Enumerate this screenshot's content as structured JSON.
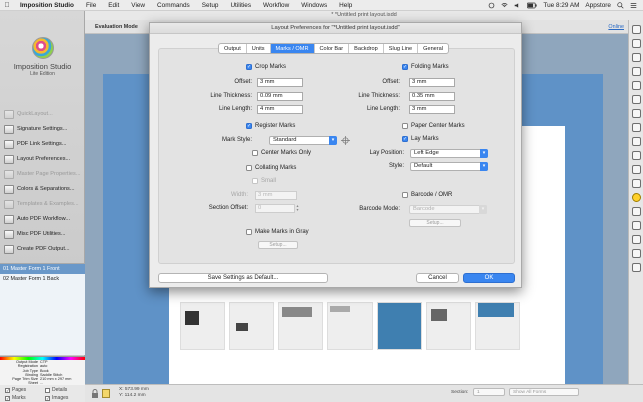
{
  "menubar": {
    "app_name": "Imposition Studio",
    "items": [
      "File",
      "Edit",
      "View",
      "Commands",
      "Setup",
      "Utilities",
      "Workflow",
      "Windows",
      "Help"
    ],
    "clock": "Tue 8:29 AM",
    "user": "Appstore"
  },
  "document": {
    "title": "* *Untitled print layout.isdd",
    "mode_label": "Evaluation Mode",
    "online_link": "Online"
  },
  "sidebar": {
    "logo_title": "Imposition Studio",
    "logo_subtitle": "Lite Edition",
    "items": [
      {
        "label": "QuickLayout...",
        "dim": true
      },
      {
        "label": "Signature Settings...",
        "dim": false
      },
      {
        "label": "PDF Link Settings...",
        "dim": false
      },
      {
        "label": "Layout Preferences...",
        "dim": false
      },
      {
        "label": "Master Page Properties...",
        "dim": true
      },
      {
        "label": "Colors & Separations...",
        "dim": false
      },
      {
        "label": "Templates & Examples...",
        "dim": true
      },
      {
        "label": "Auto PDF Workflow...",
        "dim": false
      },
      {
        "label": "Misc PDF Utilities...",
        "dim": false
      },
      {
        "label": "Create PDF Output...",
        "dim": false
      }
    ],
    "forms": [
      "01 Master Form 1 Front",
      "02 Master Form 1 Back"
    ],
    "info": [
      {
        "k": "Output Mode",
        "v": "CTP"
      },
      {
        "k": "Registration",
        "v": "auto"
      },
      {
        "k": "Job Type",
        "v": "Book"
      },
      {
        "k": "Binding",
        "v": "Saddle Stitch"
      },
      {
        "k": "Page Trim Size",
        "v": "210 mm x 297 mm"
      },
      {
        "k": "Sheet",
        "v": "..."
      }
    ]
  },
  "statusbar": {
    "checks": [
      {
        "label": "Pages",
        "checked": true
      },
      {
        "label": "Details",
        "checked": false
      },
      {
        "label": "Marks",
        "checked": true
      },
      {
        "label": "Images",
        "checked": true
      }
    ],
    "x_readout": "X: 573.99 mm",
    "y_readout": "Y: 114.2 mm",
    "section_label": "Section:",
    "section_value": "1",
    "forms_filter": "Show All Forms"
  },
  "dialog": {
    "title": "Layout Preferences for \"*Untitled print layout.isdd\"",
    "tabs": [
      "Output",
      "Units",
      "Marks / OMR",
      "Color Bar",
      "Backdrop",
      "Slug Line",
      "General"
    ],
    "active_tab": "Marks / OMR",
    "crop_marks": {
      "label": "Crop Marks",
      "checked": true
    },
    "crop_offset": {
      "label": "Offset:",
      "value": "3 mm"
    },
    "crop_thickness": {
      "label": "Line Thickness:",
      "value": "0.09 mm"
    },
    "crop_length": {
      "label": "Line Length:",
      "value": "4 mm"
    },
    "folding_marks": {
      "label": "Folding Marks",
      "checked": true
    },
    "fold_offset": {
      "label": "Offset:",
      "value": "3 mm"
    },
    "fold_thickness": {
      "label": "Line Thickness:",
      "value": "0.35 mm"
    },
    "fold_length": {
      "label": "Line Length:",
      "value": "3 mm"
    },
    "register_marks": {
      "label": "Register Marks",
      "checked": true
    },
    "mark_style": {
      "label": "Mark Style:",
      "value": "Standard"
    },
    "center_marks_only": {
      "label": "Center Marks Only",
      "checked": false
    },
    "paper_center_marks": {
      "label": "Paper Center Marks",
      "checked": false
    },
    "lay_marks": {
      "label": "Lay Marks",
      "checked": true
    },
    "lay_position": {
      "label": "Lay Position:",
      "value": "Left Edge"
    },
    "lay_style": {
      "label": "Style:",
      "value": "Default"
    },
    "collating_marks": {
      "label": "Collating Marks",
      "checked": false
    },
    "small": {
      "label": "Small",
      "checked": false
    },
    "collate_width": {
      "label": "Width:",
      "value": "3 mm"
    },
    "section_offset": {
      "label": "Section Offset:",
      "value": "0"
    },
    "barcode_omr": {
      "label": "Barcode / OMR",
      "checked": false
    },
    "barcode_mode": {
      "label": "Barcode Mode:",
      "value": "Barcode"
    },
    "barcode_setup": "Setup...",
    "gray_marks": {
      "label": "Make Marks in Gray",
      "checked": false
    },
    "gray_setup": "Setup...",
    "save_default": "Save Settings as Default...",
    "cancel": "Cancel",
    "ok": "OK"
  },
  "colors": {
    "accent": "#3a86f0",
    "selection": "#6a98c9",
    "page_blue": "#5f92c7"
  }
}
